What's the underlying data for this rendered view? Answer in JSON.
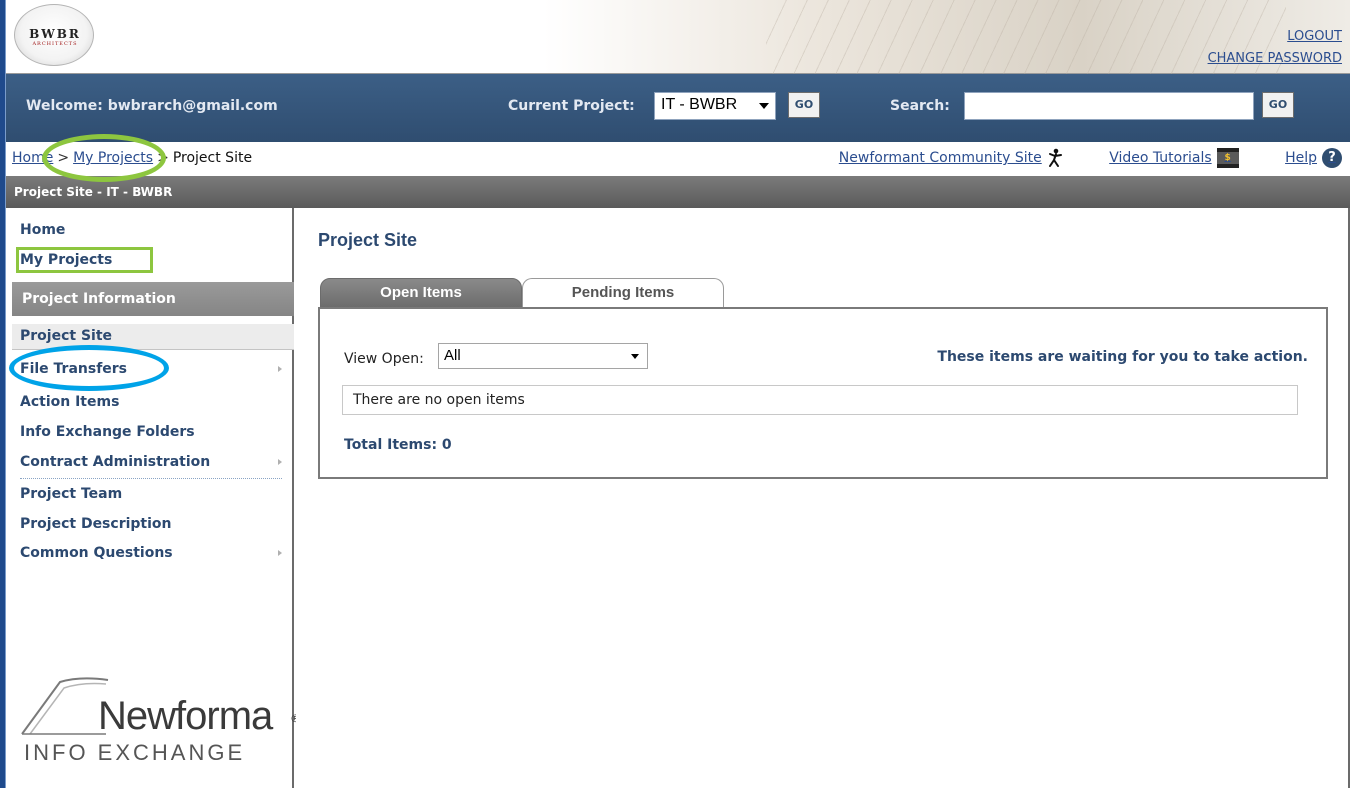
{
  "header": {
    "logo_text": "BWBR",
    "logo_sub": "ARCHITECTS",
    "logout": "LOGOUT",
    "change_password": "CHANGE PASSWORD"
  },
  "topbar": {
    "welcome": "Welcome: bwbrarch@gmail.com",
    "current_project_label": "Current Project:",
    "current_project_value": "IT - BWBR",
    "go_label": "GO",
    "search_label": "Search:",
    "search_value": "",
    "search_go_label": "GO"
  },
  "breadcrumb": {
    "home": "Home",
    "sep": ">",
    "my_projects": "My Projects",
    "current": "Project Site"
  },
  "utility_links": {
    "community": "Newformant Community Site",
    "video": "Video Tutorials",
    "help": "Help",
    "help_icon_glyph": "?",
    "film_icon_glyph": "$"
  },
  "site_bar": {
    "title": "Project Site - IT - BWBR"
  },
  "sidebar": {
    "home": "Home",
    "my_projects": "My Projects",
    "group_header": "Project Information",
    "items": [
      {
        "label": "Project Site",
        "submenu": false
      },
      {
        "label": "File Transfers",
        "submenu": true
      },
      {
        "label": "Action Items",
        "submenu": false
      },
      {
        "label": "Info Exchange Folders",
        "submenu": false
      },
      {
        "label": "Contract Administration",
        "submenu": true
      },
      {
        "label": "Project Team",
        "submenu": false
      },
      {
        "label": "Project Description",
        "submenu": false
      },
      {
        "label": "Common Questions",
        "submenu": true
      }
    ],
    "brand_word": "Newforma",
    "brand_reg": "®",
    "brand_sub": "INFO EXCHANGE"
  },
  "main": {
    "title": "Project Site",
    "tabs": [
      {
        "label": "Open Items",
        "active": true
      },
      {
        "label": "Pending Items",
        "active": false
      }
    ],
    "view_label": "View Open:",
    "view_value": "All",
    "waiting_text": "These items are waiting for you to take action.",
    "empty_text": "There are no open items",
    "total_text": "Total Items: 0"
  },
  "icons": {
    "logo": "bwbr-logo-icon",
    "community": "figure-icon",
    "video": "film-clapper-icon",
    "help": "help-icon",
    "dropdown": "chevron-down-icon",
    "submenu": "chevron-right-icon"
  },
  "colors": {
    "nav_dark": "#2f4d70",
    "link_blue": "#2b4d8f",
    "label_blue": "#2c4970",
    "highlight_green": "#8dc63f",
    "highlight_blue": "#00a3e8"
  }
}
